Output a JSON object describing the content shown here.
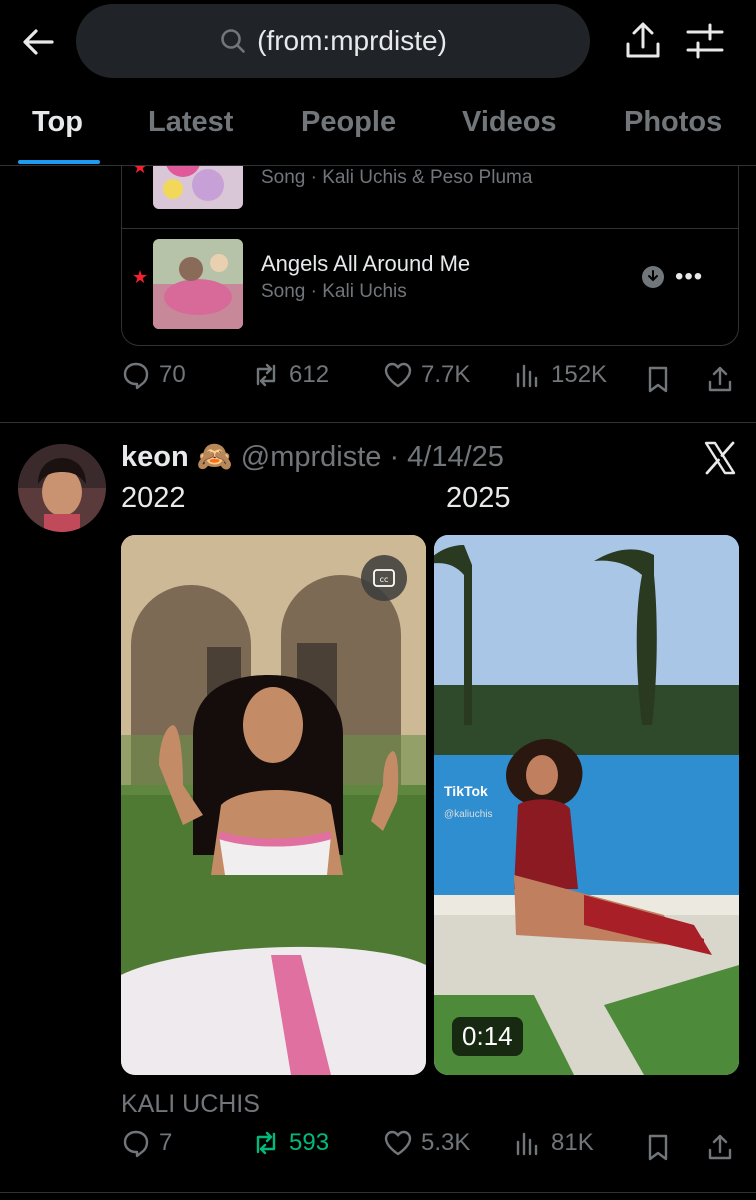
{
  "search": {
    "query": "(from:mprdiste)"
  },
  "tabs": [
    {
      "label": "Top",
      "active": true
    },
    {
      "label": "Latest"
    },
    {
      "label": "People"
    },
    {
      "label": "Videos"
    },
    {
      "label": "Photos"
    }
  ],
  "songs": [
    {
      "title": "",
      "meta": "Song · Kali Uchis & Peso Pluma"
    },
    {
      "title": "Angels All Around Me",
      "meta": "Song · Kali Uchis"
    }
  ],
  "post1_stats": {
    "replies": "70",
    "reposts": "612",
    "likes": "7.7K",
    "views": "152K"
  },
  "tweet": {
    "name": "keon",
    "emoji": "🙈",
    "handle": "@mprdiste",
    "date": "· 4/14/25",
    "text_left": "2022",
    "text_right": "2025",
    "video_duration": "0:14",
    "tiktok_label": "TikTok",
    "tiktok_user": "@kaliuchis",
    "caption": "KALI UCHIS",
    "stats": {
      "replies": "7",
      "reposts": "593",
      "likes": "5.3K",
      "views": "81K"
    }
  },
  "colors": {
    "accent": "#1d9bf0",
    "repost_green": "#00ba7c",
    "muted": "#71767b",
    "star_red": "#f4212e"
  }
}
